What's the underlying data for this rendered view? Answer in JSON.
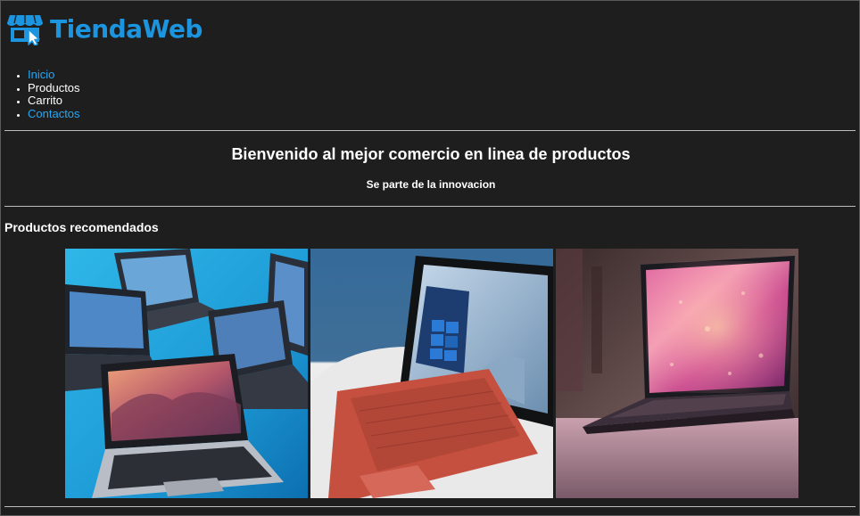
{
  "brand": {
    "name": "TiendaWeb",
    "color": "#1c95e0"
  },
  "nav": {
    "items": [
      {
        "label": "Inicio",
        "is_link": true
      },
      {
        "label": "Productos",
        "is_link": false
      },
      {
        "label": "Carrito",
        "is_link": false
      },
      {
        "label": "Contactos",
        "is_link": true
      }
    ]
  },
  "hero": {
    "title": "Bienvenido al mejor comercio en linea de productos",
    "subtitle": "Se parte de la innovacion"
  },
  "recommended": {
    "heading": "Productos recomendados",
    "products": [
      {
        "image": "laptops-group-blue-background"
      },
      {
        "image": "tablet-with-red-keyboard"
      },
      {
        "image": "laptop-pink-wallpaper"
      }
    ]
  },
  "colors": {
    "background": "#1e1e1e",
    "link": "#27a7f2",
    "text": "#ffffff",
    "rule": "#bdbdbd"
  }
}
